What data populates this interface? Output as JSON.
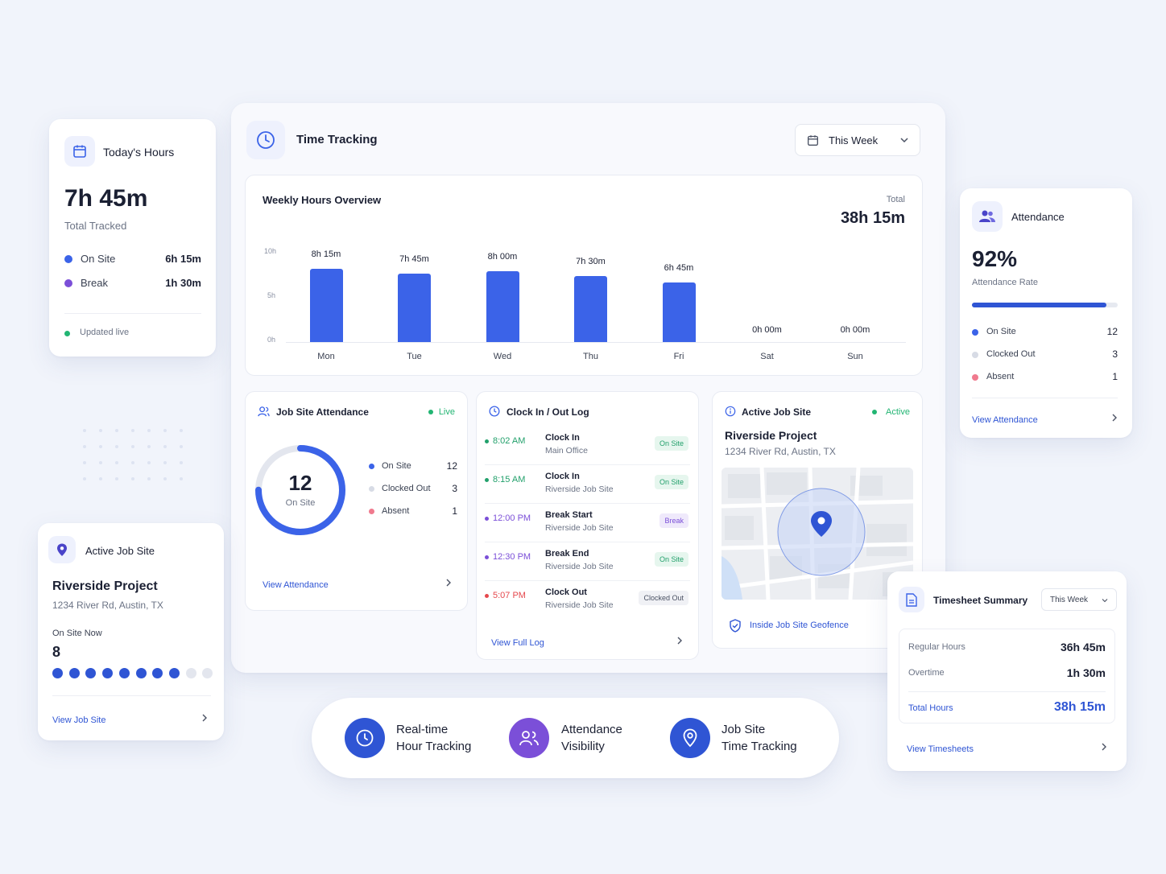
{
  "todays_hours": {
    "title": "Today's Hours",
    "total": "7h 45m",
    "total_label": "Total Tracked",
    "rows": [
      {
        "label": "On Site",
        "value": "6h 15m",
        "color": "#3b63e8"
      },
      {
        "label": "Break",
        "value": "1h 30m",
        "color": "#7b4fd8"
      }
    ],
    "status": "Updated live",
    "status_color": "#22b573"
  },
  "time_tracking": {
    "title": "Time Tracking",
    "range": "This Week",
    "overview_title": "Weekly Hours Overview",
    "total_label": "Total",
    "total_value": "38h 15m"
  },
  "chart_data": {
    "type": "bar",
    "title": "Weekly Hours Overview",
    "categories": [
      "Mon",
      "Tue",
      "Wed",
      "Thu",
      "Fri",
      "Sat",
      "Sun"
    ],
    "values": [
      8.25,
      7.75,
      8.0,
      7.5,
      6.75,
      0,
      0
    ],
    "value_labels": [
      "8h 15m",
      "7h 45m",
      "8h 00m",
      "7h 30m",
      "6h 45m",
      "0h 00m",
      "0h 00m"
    ],
    "yticks": [
      "10h",
      "5h",
      "0h"
    ],
    "ylim": [
      0,
      10
    ],
    "color": "#3b63e8"
  },
  "job_site_attendance": {
    "title": "Job Site Attendance",
    "status": "Live",
    "count": "12",
    "count_label": "On Site",
    "on_site_fraction": 0.75,
    "legend": [
      {
        "label": "On Site",
        "value": "12",
        "color": "#3b63e8"
      },
      {
        "label": "Clocked Out",
        "value": "3",
        "color": "#d7dbe5"
      },
      {
        "label": "Absent",
        "value": "1",
        "color": "#f07a8e"
      }
    ],
    "link": "View Attendance"
  },
  "clock_log": {
    "title": "Clock In / Out Log",
    "rows": [
      {
        "time": "8:02 AM",
        "action": "Clock In",
        "place": "Main Office",
        "badge": "On Site",
        "color": "#22a06b",
        "badge_bg": "#e6f6ee",
        "badge_fg": "#22a06b"
      },
      {
        "time": "8:15 AM",
        "action": "Clock In",
        "place": "Riverside Job Site",
        "badge": "On Site",
        "color": "#22a06b",
        "badge_bg": "#e6f6ee",
        "badge_fg": "#22a06b"
      },
      {
        "time": "12:00 PM",
        "action": "Break Start",
        "place": "Riverside Job Site",
        "badge": "Break",
        "color": "#7b4fd8",
        "badge_bg": "#efe9fb",
        "badge_fg": "#7b4fd8"
      },
      {
        "time": "12:30 PM",
        "action": "Break End",
        "place": "Riverside Job Site",
        "badge": "On Site",
        "color": "#7b4fd8",
        "badge_bg": "#e6f6ee",
        "badge_fg": "#22a06b"
      },
      {
        "time": "5:07 PM",
        "action": "Clock Out",
        "place": "Riverside Job Site",
        "badge": "Clocked Out",
        "color": "#e5484d",
        "badge_bg": "#f0f1f5",
        "badge_fg": "#4a5163"
      }
    ],
    "link": "View Full Log"
  },
  "active_site_main": {
    "title": "Active Job Site",
    "status": "Active",
    "project": "Riverside Project",
    "address": "1234 River Rd, Austin, TX",
    "geofence": "Inside Job Site Geofence"
  },
  "attendance": {
    "title": "Attendance",
    "rate": "92%",
    "rate_label": "Attendance Rate",
    "rate_fraction": 0.92,
    "legend": [
      {
        "label": "On Site",
        "value": "12",
        "color": "#3b63e8"
      },
      {
        "label": "Clocked Out",
        "value": "3",
        "color": "#d7dbe5"
      },
      {
        "label": "Absent",
        "value": "1",
        "color": "#f07a8e"
      }
    ],
    "link": "View Attendance"
  },
  "active_site_left": {
    "title": "Active Job Site",
    "project": "Riverside Project",
    "address": "1234 River Rd, Austin, TX",
    "on_site_label": "On Site Now",
    "on_site_count": "8",
    "filled_dots": 8,
    "total_dots": 10,
    "link": "View Job Site"
  },
  "timesheet": {
    "title": "Timesheet Summary",
    "range": "This Week",
    "rows": [
      {
        "label": "Regular Hours",
        "value": "36h 45m"
      },
      {
        "label": "Overtime",
        "value": "1h 30m"
      }
    ],
    "total_label": "Total Hours",
    "total_value": "38h 15m",
    "link": "View Timesheets"
  },
  "features": [
    {
      "line1": "Real-time",
      "line2": "Hour Tracking",
      "icon": "clock-icon",
      "color": "#2f55d4"
    },
    {
      "line1": "Attendance",
      "line2": "Visibility",
      "icon": "users-icon",
      "color": "#7b4fd8"
    },
    {
      "line1": "Job Site",
      "line2": "Time Tracking",
      "icon": "map-pin-icon",
      "color": "#2f55d4"
    }
  ]
}
